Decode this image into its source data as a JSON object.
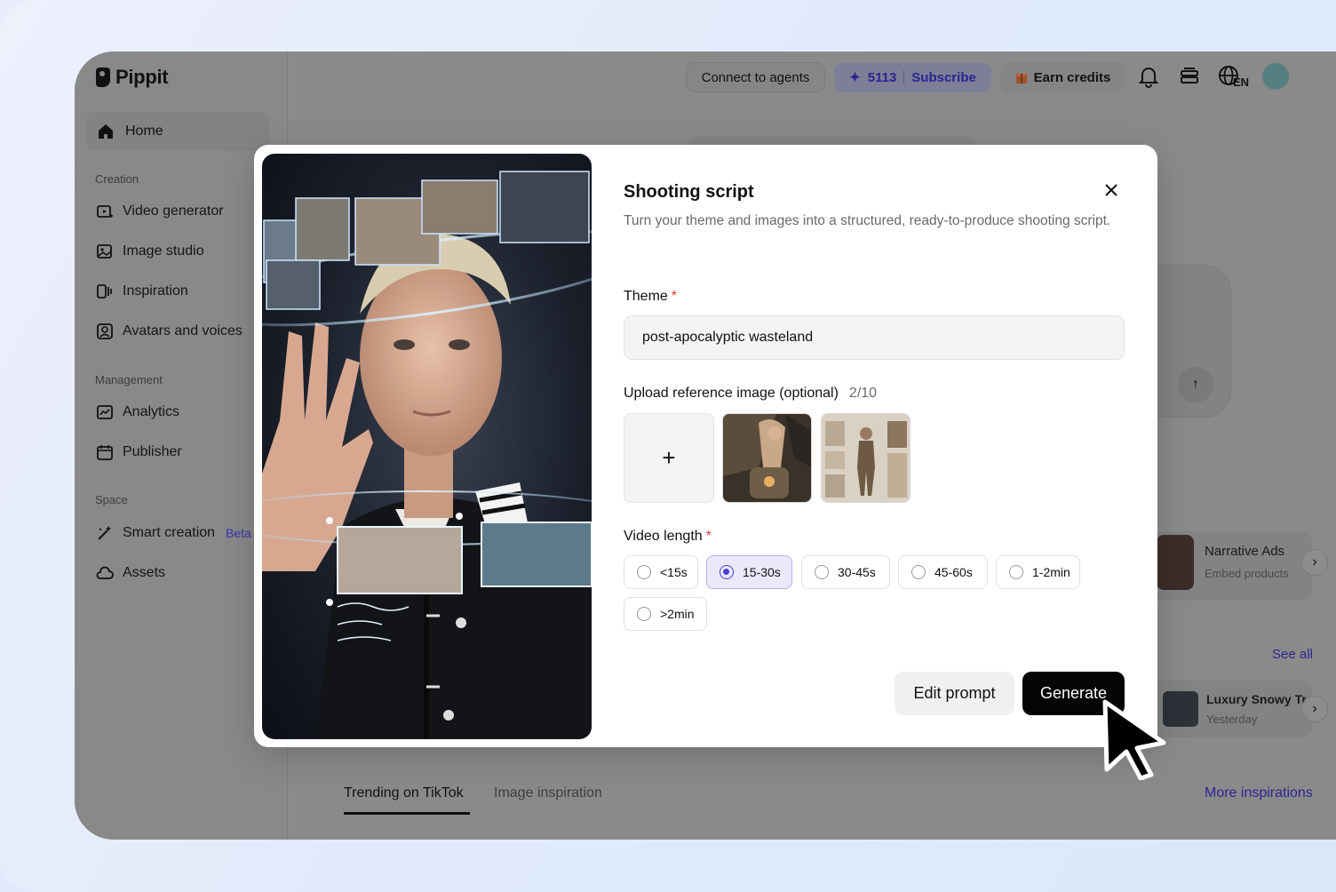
{
  "brand": {
    "name": "Pippit"
  },
  "sidebar": {
    "home_label": "Home",
    "sections": {
      "creation": "Creation",
      "management": "Management",
      "space": "Space"
    },
    "creation_items": [
      {
        "label": "Video generator",
        "icon": "video-generator-icon"
      },
      {
        "label": "Image studio",
        "icon": "image-studio-icon"
      },
      {
        "label": "Inspiration",
        "icon": "inspiration-icon"
      },
      {
        "label": "Avatars and voices",
        "icon": "avatar-icon"
      }
    ],
    "management_items": [
      {
        "label": "Analytics",
        "icon": "analytics-icon"
      },
      {
        "label": "Publisher",
        "icon": "calendar-icon"
      }
    ],
    "space_items": [
      {
        "label": "Smart creation",
        "badge": "Beta",
        "icon": "magic-wand-icon"
      },
      {
        "label": "Assets",
        "icon": "cloud-icon"
      }
    ]
  },
  "topbar": {
    "connect_label": "Connect to agents",
    "credits": "5113",
    "subscribe_label": "Subscribe",
    "earn_label": "Earn credits",
    "language": "EN"
  },
  "background": {
    "narrative_title": "Narrative Ads",
    "narrative_sub": "Embed products",
    "see_all": "See all",
    "recent_title": "Luxury Snowy Tr",
    "recent_time": "Yesterday",
    "tabs": [
      "Trending on TikTok",
      "Image inspiration"
    ],
    "more_inspirations": "More inspirations"
  },
  "modal": {
    "title": "Shooting script",
    "description": "Turn your theme and images into a structured, ready-to-produce shooting script.",
    "theme_label": "Theme",
    "required_mark": "*",
    "theme_value": "post-apocalyptic wasteland",
    "upload_label": "Upload reference image (optional)",
    "upload_count": "2/10",
    "upload_plus": "+",
    "video_length_label": "Video length",
    "video_length_options": [
      "<15s",
      "15-30s",
      "30-45s",
      "45-60s",
      "1-2min",
      ">2min"
    ],
    "video_length_selected": "15-30s",
    "edit_prompt_label": "Edit prompt",
    "generate_label": "Generate"
  },
  "colors": {
    "accent": "#4b3fd6",
    "accent_bg": "#ebe8fc",
    "required": "#e23a3a",
    "primary_button": "#050505",
    "link": "#2d2690"
  }
}
